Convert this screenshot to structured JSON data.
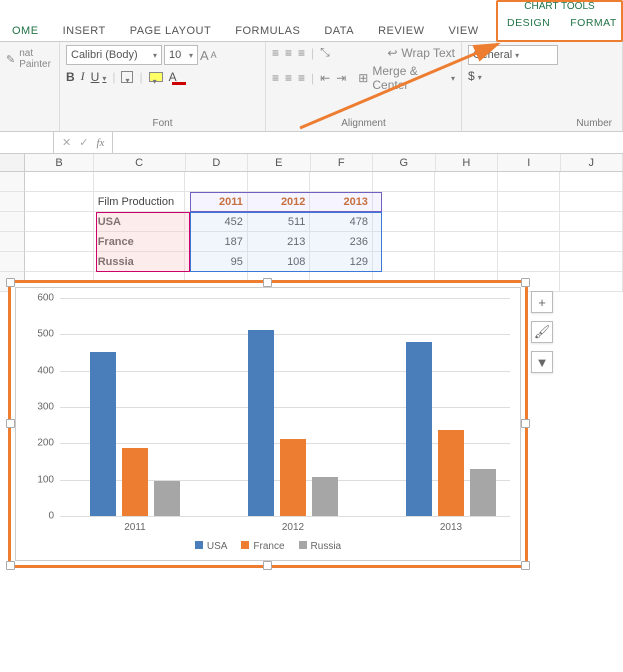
{
  "qat": {
    "redo_tip": "↺"
  },
  "tabs": {
    "home": "OME",
    "insert": "INSERT",
    "pagelayout": "PAGE LAYOUT",
    "formulas": "FORMULAS",
    "data": "DATA",
    "review": "REVIEW",
    "view": "VIEW"
  },
  "chart_tools": {
    "header": "CHART TOOLS",
    "design": "DESIGN",
    "format": "FORMAT"
  },
  "ribbon": {
    "clipboard": {
      "format_painter": "nat Painter"
    },
    "font": {
      "name": "Calibri (Body)",
      "size": "10",
      "b": "B",
      "i": "I",
      "u": "U",
      "a_big": "A",
      "a_small": "A",
      "label": "Font"
    },
    "alignment": {
      "wrap": "Wrap Text",
      "merge": "Merge & Center",
      "label": "Alignment"
    },
    "number": {
      "format": "General",
      "currency": "$",
      "label": "Number"
    }
  },
  "fx": {
    "fx": "fx"
  },
  "columns": {
    "B": "B",
    "C": "C",
    "D": "D",
    "E": "E",
    "F": "F",
    "G": "G",
    "H": "H",
    "I": "I",
    "J": "J"
  },
  "table": {
    "corner": "Film Production",
    "years": [
      "2011",
      "2012",
      "2013"
    ],
    "rows": [
      {
        "label": "USA",
        "vals": [
          "452",
          "511",
          "478"
        ]
      },
      {
        "label": "France",
        "vals": [
          "187",
          "213",
          "236"
        ]
      },
      {
        "label": "Russia",
        "vals": [
          "95",
          "108",
          "129"
        ]
      }
    ]
  },
  "chart_data": {
    "type": "bar",
    "categories": [
      "2011",
      "2012",
      "2013"
    ],
    "series": [
      {
        "name": "USA",
        "values": [
          452,
          511,
          478
        ],
        "color": "#4a7ebb"
      },
      {
        "name": "France",
        "values": [
          187,
          213,
          236
        ],
        "color": "#ed7d31"
      },
      {
        "name": "Russia",
        "values": [
          95,
          108,
          129
        ],
        "color": "#a6a6a6"
      }
    ],
    "ylim": [
      0,
      600
    ],
    "ystep": 100,
    "yticks": [
      "0",
      "100",
      "200",
      "300",
      "400",
      "500",
      "600"
    ],
    "title": "",
    "xlabel": "",
    "ylabel": ""
  },
  "chart_side": {
    "plus": "+",
    "brush": "🖌",
    "funnel": "▼"
  }
}
